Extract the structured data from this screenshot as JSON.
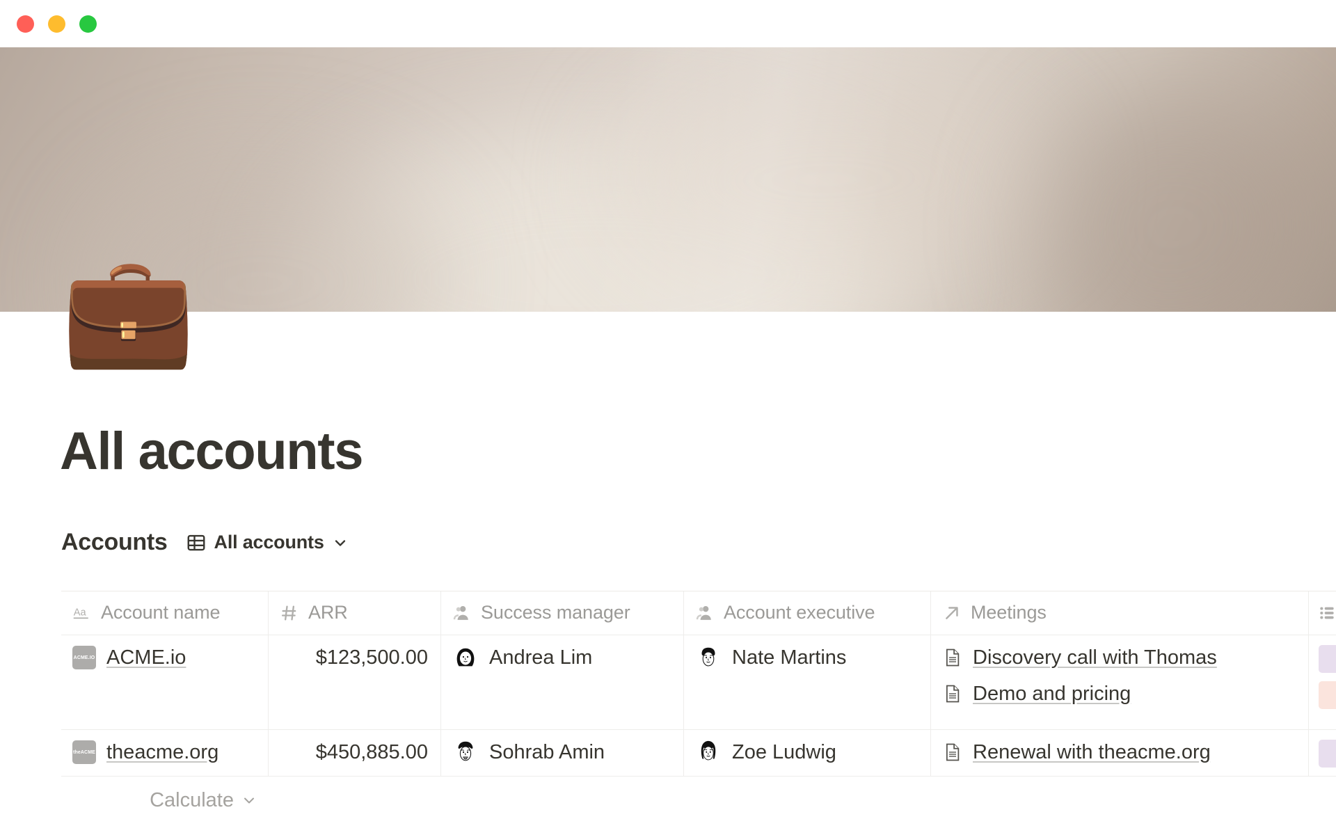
{
  "window": {
    "traffic_lights": [
      {
        "name": "close",
        "color": "#ff5f57"
      },
      {
        "name": "minimize",
        "color": "#febc2e"
      },
      {
        "name": "maximize",
        "color": "#28c840"
      }
    ]
  },
  "page": {
    "icon": "💼",
    "icon_name": "briefcase-emoji",
    "title": "All accounts",
    "cover_colors": [
      "#b6a89d",
      "#ded5cd",
      "#ab9c8f"
    ]
  },
  "database": {
    "title": "Accounts",
    "view_icon": "table-icon",
    "view_name": "All accounts",
    "view_chevron": "chevron-down-icon",
    "columns": [
      {
        "label": "Account name",
        "icon": "title-text-icon",
        "type": "title"
      },
      {
        "label": "ARR",
        "icon": "number-hash-icon",
        "type": "number"
      },
      {
        "label": "Success manager",
        "icon": "person-icon",
        "type": "person"
      },
      {
        "label": "Account executive",
        "icon": "person-icon",
        "type": "person"
      },
      {
        "label": "Meetings",
        "icon": "relation-arrow-icon",
        "type": "relation"
      },
      {
        "label": "",
        "icon": "multi-select-icon",
        "type": "multi-select"
      }
    ],
    "rows": [
      {
        "account_name": "ACME.io",
        "logo_text": "ACME.IO",
        "arr": "$123,500.00",
        "success_manager": "Andrea Lim",
        "account_executive": "Nate Martins",
        "meetings": [
          "Discovery call with Thomas",
          "Demo and pricing"
        ],
        "tags": [
          "#e8deee",
          "#fbe4dd"
        ]
      },
      {
        "account_name": "theacme.org",
        "logo_text": "theACME",
        "arr": "$450,885.00",
        "success_manager": "Sohrab Amin",
        "account_executive": "Zoe Ludwig",
        "meetings": [
          "Renewal with theacme.org"
        ],
        "tags": [
          "#e8deee"
        ]
      }
    ],
    "footer": {
      "calculate_label": "Calculate",
      "calculate_chevron": "chevron-down-icon"
    }
  }
}
